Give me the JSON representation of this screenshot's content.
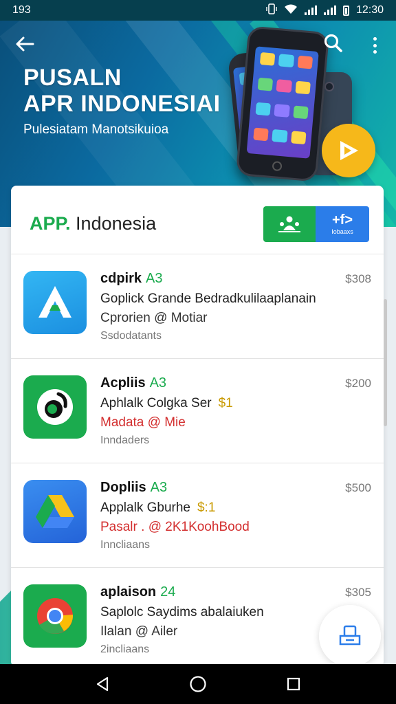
{
  "status_bar": {
    "left_text": "193",
    "time": "12:30"
  },
  "header": {
    "title_line1": "PUSALN",
    "title_line2": "APR INDONESIAI",
    "subtitle": "Pulesiatam Manotsikuioa"
  },
  "card": {
    "brand_accent": "APP.",
    "brand_name": " Indonesia",
    "blue_button_main": "+f>",
    "blue_button_sub": "Iobaaxs"
  },
  "apps": [
    {
      "title": "cdpirk",
      "version": "A3",
      "price": "$308",
      "line2": "Goplick Grande Bedradkulilaaplanain",
      "line2_tag": "",
      "line3": "Cprorien @ Motiar",
      "line3_color": "#333333",
      "line4": "Ssdodatants",
      "icon": "a-letter-icon"
    },
    {
      "title": "Acpliis",
      "version": "A3",
      "price": "$200",
      "line2": "Aphlalk Colgka Ser",
      "line2_tag": "$1",
      "line3": "Madata @ Mie",
      "line3_color": "#d32f2f",
      "line4": "Inndaders",
      "icon": "green-bird-icon"
    },
    {
      "title": "Dopliis",
      "version": "A3",
      "price": "$500",
      "line2": "Applalk Gburhe",
      "line2_tag": "$:1",
      "line3": "Pasalr . @ 2K1KoohBood",
      "line3_color": "#d32f2f",
      "line4": "Inncliaans",
      "icon": "drive-icon"
    },
    {
      "title": "aplaison",
      "version": "24",
      "price": "$305",
      "line2": "Saplolc Saydims abalaiuken",
      "line2_tag": "",
      "line3": "Ilalan @ Ailer",
      "line3_color": "#333333",
      "line4": "2incliaans",
      "icon": "chrome-icon"
    }
  ],
  "colors": {
    "accent_green": "#1bab4e",
    "accent_blue": "#2b7de9",
    "header_start": "#0a4f7a",
    "header_end": "#13b6a8"
  }
}
